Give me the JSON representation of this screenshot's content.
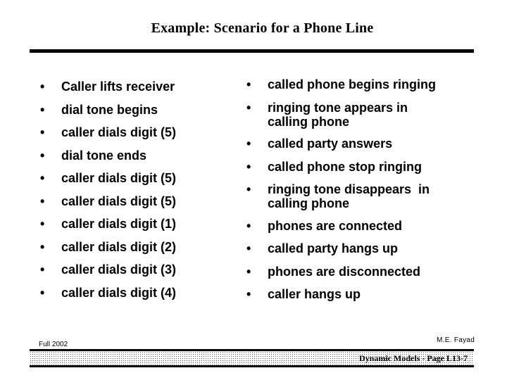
{
  "slide": {
    "title": "Example: Scenario for a Phone Line",
    "bullet_glyph": "•",
    "left_column": [
      "Caller lifts receiver",
      "dial tone begins",
      "caller dials digit (5)",
      "dial tone ends",
      "caller dials digit (5)",
      "caller dials digit (5)",
      "caller dials digit (1)",
      "caller dials digit (2)",
      "caller dials digit (3)",
      "caller dials digit (4)"
    ],
    "right_column": [
      {
        "line1": "called phone begins ringing"
      },
      {
        "line1": "ringing tone appears in",
        "line2": "calling phone"
      },
      {
        "line1": "called party answers"
      },
      {
        "line1": "called phone stop ringing"
      },
      {
        "line1": "ringing tone disappears  in",
        "line2": "calling phone"
      },
      {
        "line1": "phones are connected"
      },
      {
        "line1": "called party hangs up"
      },
      {
        "line1": "phones are disconnected"
      },
      {
        "line1": "caller hangs up"
      }
    ]
  },
  "footer": {
    "term": "Full 2002",
    "author": "M.E. Fayad",
    "page_label": "Dynamic Models - Page L13-7"
  }
}
